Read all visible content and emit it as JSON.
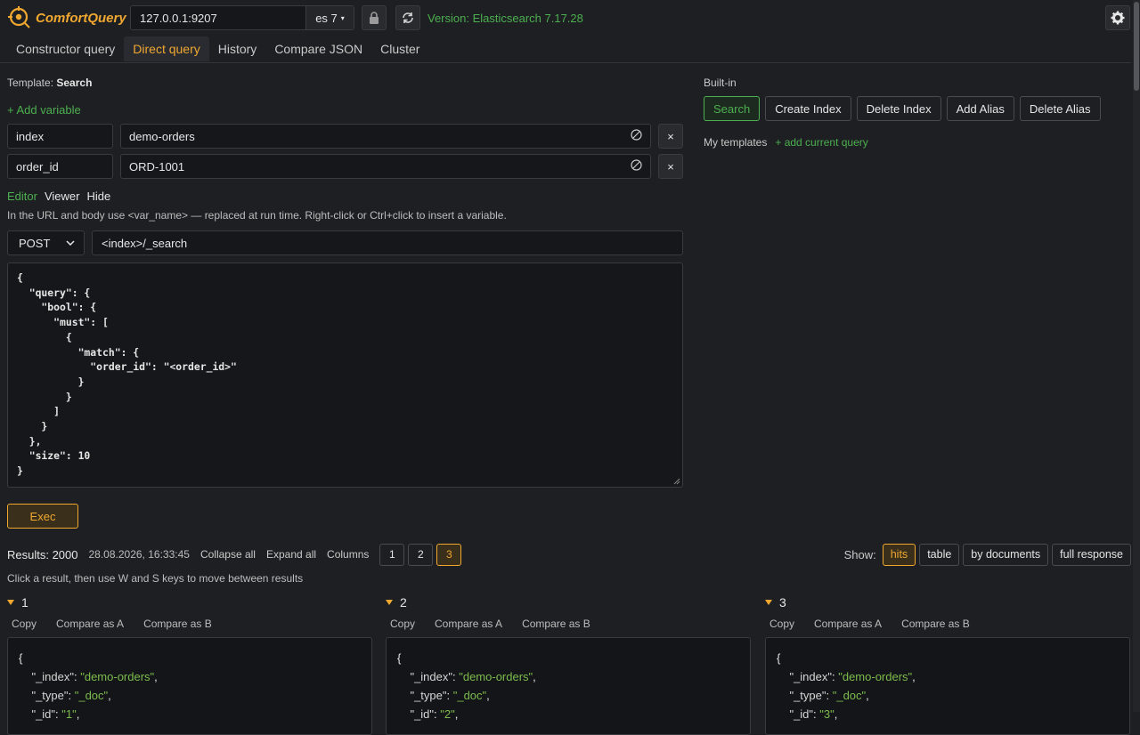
{
  "app": {
    "name": "ComfortQuery"
  },
  "toolbar": {
    "host": "127.0.0.1:9207",
    "es_version": "es 7",
    "version_text": "Version: Elasticsearch 7.17.28"
  },
  "tabs": [
    "Constructor query",
    "Direct query",
    "History",
    "Compare JSON",
    "Cluster"
  ],
  "template": {
    "label": "Template:",
    "name": "Search"
  },
  "add_variable": "+ Add variable",
  "variables": [
    {
      "name": "index",
      "value": "demo-orders"
    },
    {
      "name": "order_id",
      "value": "ORD-1001"
    }
  ],
  "modes": [
    "Editor",
    "Viewer",
    "Hide"
  ],
  "hint": "In the URL and body use <var_name> — replaced at run time. Right-click or Ctrl+click to insert a variable.",
  "request": {
    "method": "POST",
    "url": "<index>/_search",
    "body": "{\n  \"query\": {\n    \"bool\": {\n      \"must\": [\n        {\n          \"match\": {\n            \"order_id\": \"<order_id>\"\n          }\n        }\n      ]\n    }\n  },\n  \"size\": 10\n}"
  },
  "exec_label": "Exec",
  "builtin": {
    "label": "Built-in",
    "buttons": [
      "Search",
      "Create Index",
      "Delete Index",
      "Add Alias",
      "Delete Alias"
    ]
  },
  "my_templates": {
    "label": "My templates",
    "add": "+ add current query"
  },
  "results": {
    "count": "Results: 2000",
    "time": "28.08.2026, 16:33:45",
    "collapse": "Collapse all",
    "expand": "Expand all",
    "columns_label": "Columns",
    "columns": [
      "1",
      "2",
      "3"
    ],
    "show_label": "Show:",
    "show_options": [
      "hits",
      "table",
      "by documents",
      "full response"
    ],
    "hint": "Click a result, then use W and S keys to move between results",
    "actions": [
      "Copy",
      "Compare as A",
      "Compare as B"
    ],
    "items": [
      {
        "num": "1",
        "index": "\"demo-orders\"",
        "type": "\"_doc\"",
        "id": "\"1\""
      },
      {
        "num": "2",
        "index": "\"demo-orders\"",
        "type": "\"_doc\"",
        "id": "\"2\""
      },
      {
        "num": "3",
        "index": "\"demo-orders\"",
        "type": "\"_doc\"",
        "id": "\"3\""
      }
    ]
  },
  "colors": {
    "accent": "#f0a830",
    "success": "#4caf50",
    "background": "#1e1f22"
  }
}
